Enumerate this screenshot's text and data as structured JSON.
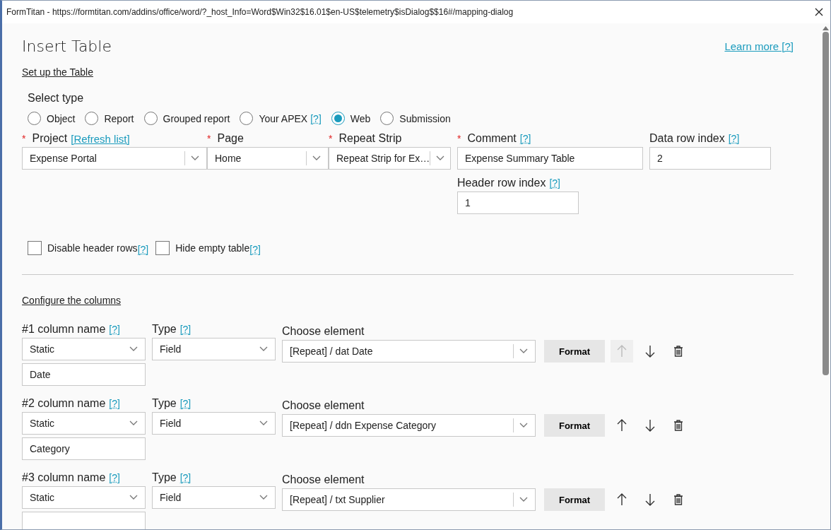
{
  "window": {
    "title": "FormTitan - https://formtitan.com/addins/office/word/?_host_Info=Word$Win32$16.01$en-US$telemetry$isDialog$$16#/mapping-dialog"
  },
  "header": {
    "title": "Insert Table",
    "learn_more": "Learn more [?]"
  },
  "setup_link": "Set up the Table",
  "select_type": {
    "label": "Select type",
    "options": [
      {
        "label": "Object",
        "selected": false
      },
      {
        "label": "Report",
        "selected": false
      },
      {
        "label": "Grouped report",
        "selected": false
      },
      {
        "label": "Your APEX",
        "help": "[?]",
        "selected": false
      },
      {
        "label": "Web",
        "selected": true
      },
      {
        "label": "Submission",
        "selected": false
      }
    ]
  },
  "selects": [
    {
      "required_mark": "*",
      "label": "Project",
      "link": "[Refresh list]",
      "value": "Expense Portal"
    },
    {
      "required_mark": "*",
      "label": "Page",
      "value": "Home"
    },
    {
      "required_mark": "*",
      "label": "Repeat Strip",
      "value": "Repeat Strip for Ex…"
    }
  ],
  "comment": {
    "required_mark": "*",
    "label": "Comment",
    "help": "[?]",
    "value": "Expense Summary Table"
  },
  "data_row_index": {
    "label": "Data row index",
    "help": "[?]",
    "value": "2"
  },
  "header_row_index": {
    "label": "Header row index",
    "help": "[?]",
    "value": "1"
  },
  "options": [
    {
      "label": "Disable header rows",
      "help": "[?]",
      "checked": false
    },
    {
      "label": "Hide empty table",
      "help": "[?]",
      "checked": false
    }
  ],
  "configure_link": "Configure the columns",
  "columns": [
    {
      "name_label": "#1 column name",
      "name_help": "[?]",
      "name_source": "Static",
      "name_value": "Date",
      "type_label": "Type",
      "type_help": "[?]",
      "type_value": "Field",
      "element_label": "Choose element",
      "element_value": "[Repeat] / dat Date",
      "format": "Format",
      "up_disabled": true
    },
    {
      "name_label": "#2 column name",
      "name_help": "[?]",
      "name_source": "Static",
      "name_value": "Category",
      "type_label": "Type",
      "type_help": "[?]",
      "type_value": "Field",
      "element_label": "Choose element",
      "element_value": "[Repeat] / ddn Expense Category",
      "format": "Format",
      "up_disabled": false
    },
    {
      "name_label": "#3 column name",
      "name_help": "[?]",
      "name_source": "Static",
      "type_label": "Type",
      "type_help": "[?]",
      "type_value": "Field",
      "element_label": "Choose element",
      "element_value": "[Repeat] / txt Supplier",
      "format": "Format",
      "up_disabled": false
    }
  ]
}
